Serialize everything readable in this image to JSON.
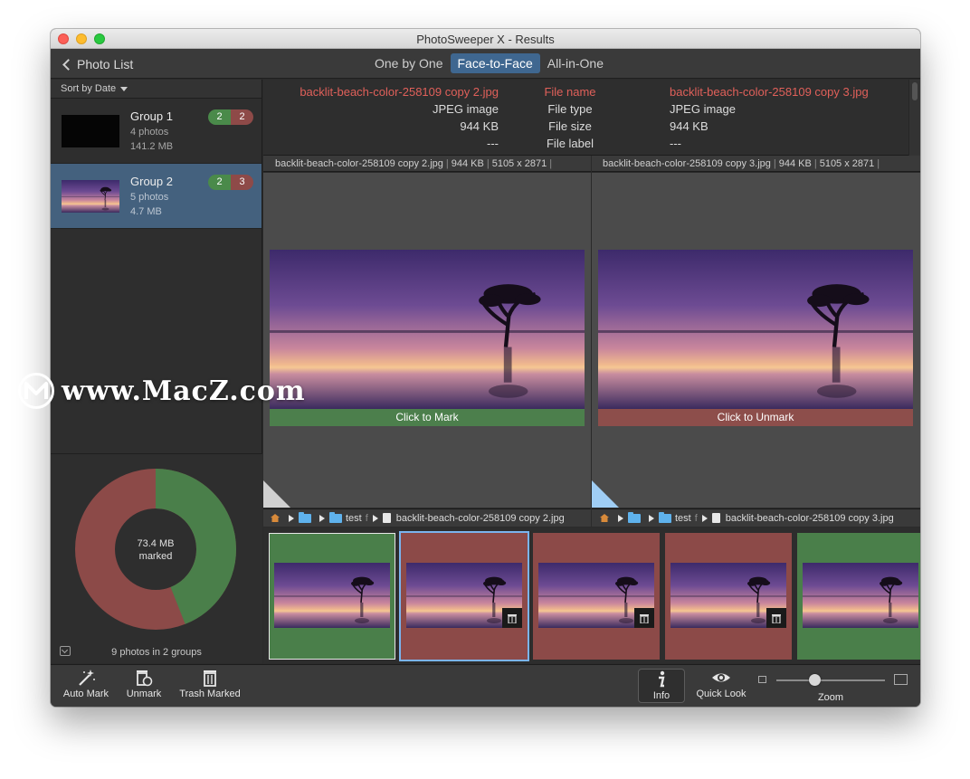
{
  "window": {
    "title": "PhotoSweeper X - Results"
  },
  "toolbar": {
    "back_label": "Photo List",
    "modes": [
      "One by One",
      "Face-to-Face",
      "All-in-One"
    ],
    "active_mode": "Face-to-Face"
  },
  "sidebar": {
    "sort_label": "Sort by Date",
    "groups": [
      {
        "title": "Group 1",
        "photos": "4 photos",
        "size": "141.2 MB",
        "badge_green": "2",
        "badge_red": "2"
      },
      {
        "title": "Group 2",
        "photos": "5 photos",
        "size": "4.7 MB",
        "badge_green": "2",
        "badge_red": "3"
      }
    ],
    "summary": {
      "donut_size": "73.4 MB",
      "donut_label": "marked",
      "marked_fraction": 0.56,
      "footer": "9 photos in 2 groups"
    }
  },
  "info": {
    "rows": [
      {
        "left": "backlit-beach-color-258109 copy 2.jpg",
        "label": "File name",
        "right": "backlit-beach-color-258109 copy 3.jpg"
      },
      {
        "left": "JPEG image",
        "label": "File type",
        "right": "JPEG image"
      },
      {
        "left": "944 KB",
        "label": "File size",
        "right": "944 KB"
      },
      {
        "left": "---",
        "label": "File label",
        "right": "---"
      }
    ]
  },
  "left_pane": {
    "header_name": "backlit-beach-color-258109 copy 2.jpg",
    "header_size": "944 KB",
    "header_dims": "5105 x 2871",
    "mark_label": "Click to Mark",
    "path_folder": "test",
    "path_trunc": "f",
    "path_file": "backlit-beach-color-258109 copy 2.jpg"
  },
  "right_pane": {
    "header_name": "backlit-beach-color-258109 copy 3.jpg",
    "header_size": "944 KB",
    "header_dims": "5105 x 2871",
    "mark_label": "Click to Unmark",
    "path_folder": "test",
    "path_trunc": "f",
    "path_file": "backlit-beach-color-258109 copy 3.jpg"
  },
  "bottom_bar": {
    "auto_mark": "Auto Mark",
    "unmark": "Unmark",
    "trash_marked": "Trash Marked",
    "info": "Info",
    "quick_look": "Quick Look",
    "zoom": "Zoom",
    "zoom_level": 0.35
  },
  "watermark": {
    "text": "www.MacZ.com"
  },
  "colors": {
    "keep_green": "#4a7f4a",
    "marked_red": "#8c4a48",
    "accent_blue": "#3f6790",
    "highlight_red": "#e0605a"
  }
}
